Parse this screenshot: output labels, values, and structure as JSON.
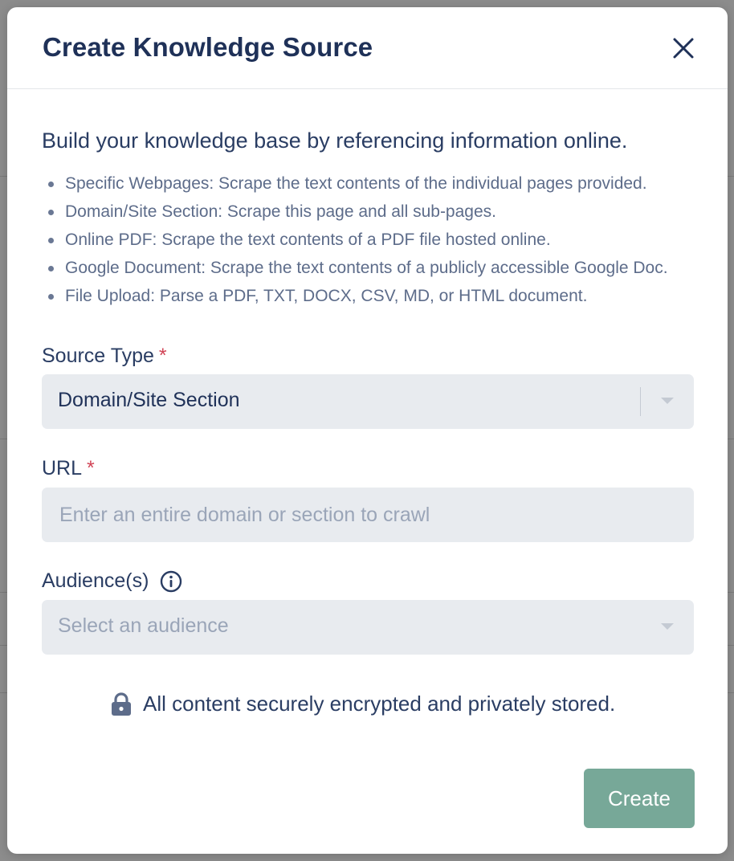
{
  "modal": {
    "title": "Create Knowledge Source",
    "intro": "Build your knowledge base by referencing information online.",
    "bullets": [
      "Specific Webpages: Scrape the text contents of the individual pages provided.",
      "Domain/Site Section: Scrape this page and all sub-pages.",
      "Online PDF: Scrape the text contents of a PDF file hosted online.",
      "Google Document: Scrape the text contents of a publicly accessible Google Doc.",
      "File Upload: Parse a PDF, TXT, DOCX, CSV, MD, or HTML document."
    ],
    "source_type": {
      "label": "Source Type",
      "required_mark": "*",
      "value": "Domain/Site Section"
    },
    "url": {
      "label": "URL",
      "required_mark": "*",
      "placeholder": "Enter an entire domain or section to crawl",
      "value": ""
    },
    "audience": {
      "label": "Audience(s)",
      "placeholder": "Select an audience"
    },
    "security_note": "All content securely encrypted and privately stored.",
    "create_label": "Create"
  },
  "icons": {
    "close": "close-icon",
    "info": "info-icon",
    "lock": "lock-icon",
    "chevron": "chevron-down-icon"
  },
  "colors": {
    "title": "#1f3158",
    "required": "#d14456",
    "create_button": "#77a898",
    "input_bg": "#e8ebef",
    "backdrop": "#8c8c8c"
  }
}
